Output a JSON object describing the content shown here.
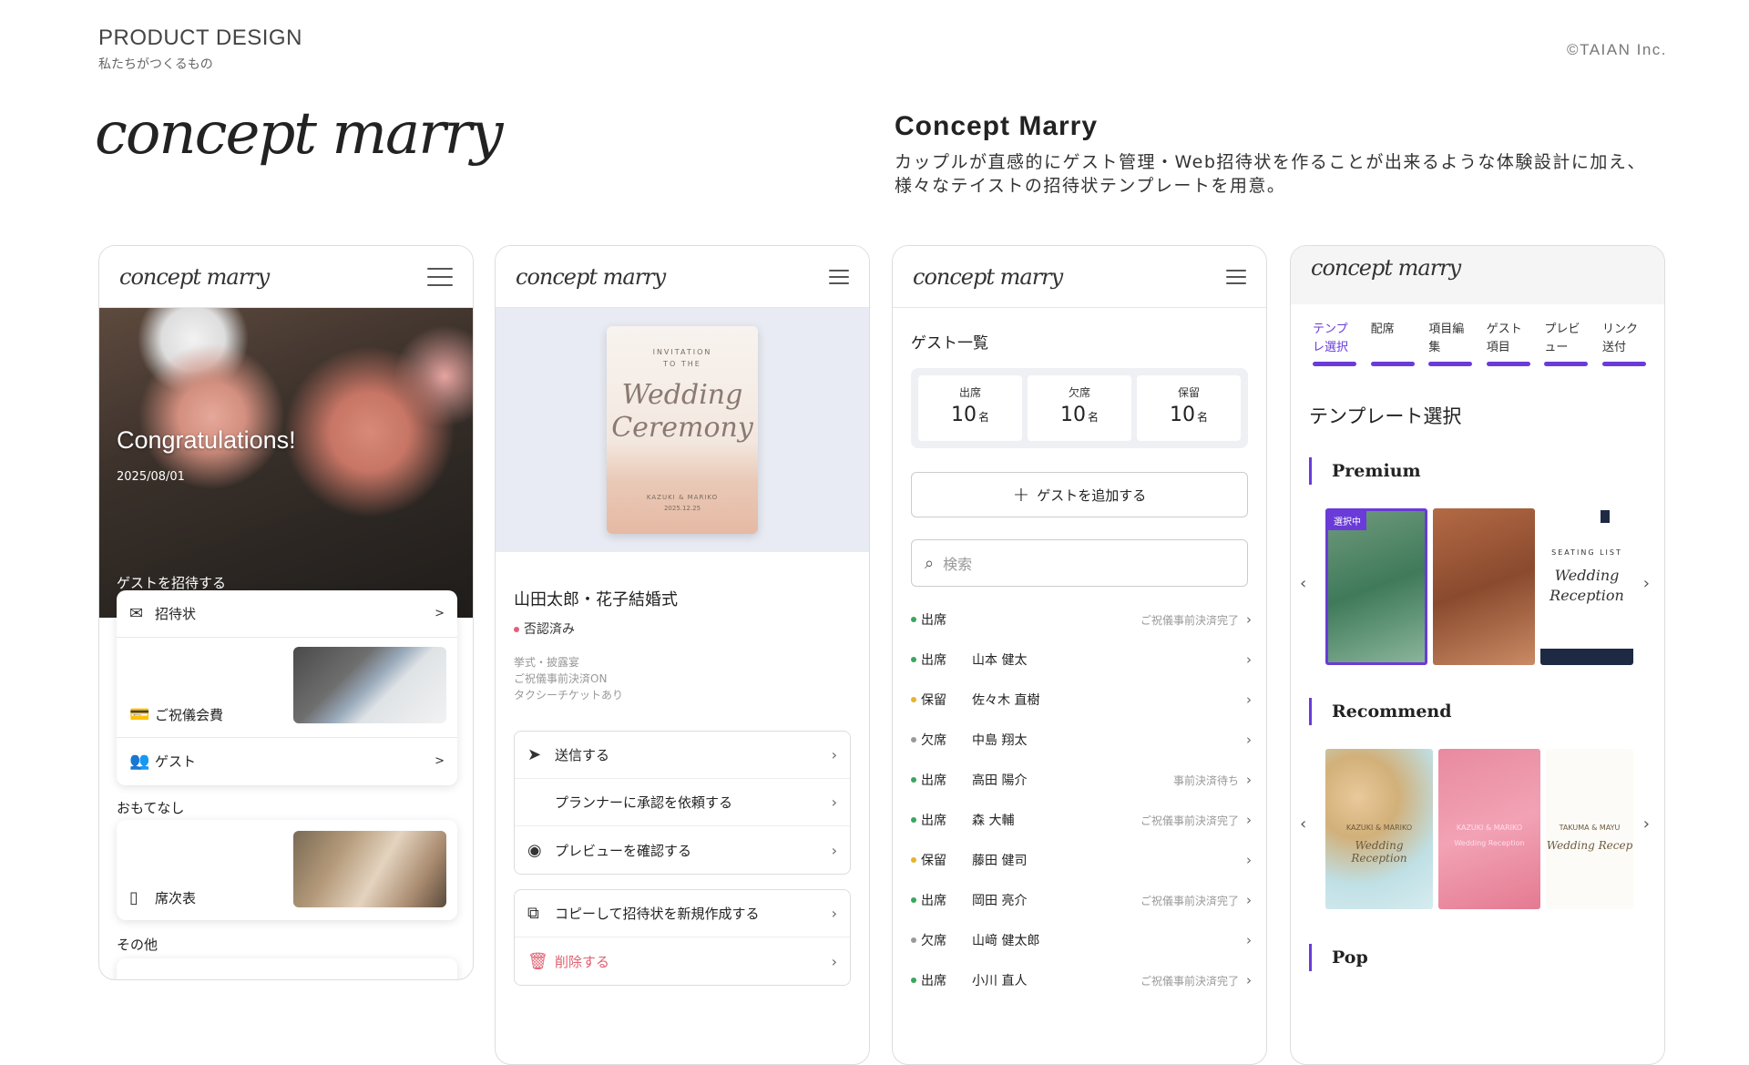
{
  "header": {
    "title": "PRODUCT DESIGN",
    "subtitle": "私たちがつくるもの",
    "copyright": "©TAIAN Inc."
  },
  "brand": {
    "logo_text": "concept marry"
  },
  "concept": {
    "title": "Concept Marry",
    "description": "カップルが直感的にゲスト管理・Web招待状を作ることが出来るような体験設計に加え、様々なテイストの招待状テンプレートを用意。"
  },
  "phone1": {
    "logo": "concept marry",
    "hero_title": "Congratulations!",
    "hero_date": "2025/08/01",
    "invite_section": "ゲストを招待する",
    "items": [
      {
        "label": "招待状",
        "icon": "envelope-icon",
        "chev": ">"
      },
      {
        "label": "ご祝儀会費",
        "icon": "money-icon",
        "chev": ">"
      },
      {
        "label": "ゲスト",
        "icon": "users-icon",
        "chev": ">"
      }
    ],
    "hospitality_section": "おもてなし",
    "seating": {
      "label": "席次表",
      "icon": "document-icon"
    },
    "other_section": "その他"
  },
  "phone2": {
    "logo": "concept marry",
    "card": {
      "line1": "INVITATION",
      "line2": "TO THE",
      "script": "Wedding Ceremony",
      "names": "KAZUKI & MARIKO",
      "date": "2025.12.25"
    },
    "event_name": "山田太郎・花子結婚式",
    "status": "否認済み",
    "notes": [
      "挙式・披露宴",
      "ご祝儀事前決済ON",
      "タクシーチケットあり"
    ],
    "actions": [
      {
        "label": "送信する",
        "icon": "send-icon"
      },
      {
        "label": "プランナーに承認を依頼する",
        "icon": ""
      },
      {
        "label": "プレビューを確認する",
        "icon": "eye-icon"
      }
    ],
    "actions2": [
      {
        "label": "コピーして招待状を新規作成する",
        "icon": "copy-icon"
      },
      {
        "label": "削除する",
        "icon": "trash-icon"
      }
    ]
  },
  "phone3": {
    "logo": "concept marry",
    "title": "ゲスト一覧",
    "stats": [
      {
        "label": "出席",
        "value": "10",
        "unit": "名"
      },
      {
        "label": "欠席",
        "value": "10",
        "unit": "名"
      },
      {
        "label": "保留",
        "value": "10",
        "unit": "名"
      }
    ],
    "add_label": "ゲストを追加する",
    "search_placeholder": "検索",
    "guests": [
      {
        "status": "出席",
        "name": "",
        "note": "ご祝儀事前決済完了",
        "color": "#3aa55d"
      },
      {
        "status": "出席",
        "name": "山本 健太",
        "note": "",
        "color": "#3aa55d"
      },
      {
        "status": "保留",
        "name": "佐々木 直樹",
        "note": "",
        "color": "#e6b32e"
      },
      {
        "status": "欠席",
        "name": "中島 翔太",
        "note": "",
        "color": "#999999"
      },
      {
        "status": "出席",
        "name": "高田 陽介",
        "note": "事前決済待ち",
        "color": "#3aa55d"
      },
      {
        "status": "出席",
        "name": "森 大輔",
        "note": "ご祝儀事前決済完了",
        "color": "#3aa55d"
      },
      {
        "status": "保留",
        "name": "藤田 健司",
        "note": "",
        "color": "#e6b32e"
      },
      {
        "status": "出席",
        "name": "岡田 亮介",
        "note": "ご祝儀事前決済完了",
        "color": "#3aa55d"
      },
      {
        "status": "欠席",
        "name": "山﨑 健太郎",
        "note": "",
        "color": "#999999"
      },
      {
        "status": "出席",
        "name": "小川 直人",
        "note": "ご祝儀事前決済完了",
        "color": "#3aa55d"
      }
    ]
  },
  "phone4": {
    "logo": "concept marry",
    "tabs": [
      "テンプレ選択",
      "配席",
      "項目編集",
      "ゲスト項目",
      "プレビュー",
      "リンク送付"
    ],
    "heading": "テンプレート選択",
    "sections": [
      "Premium",
      "Recommend",
      "Pop"
    ],
    "selected_badge": "選択中",
    "premium_texts": [
      "SEATING LIST",
      "Wedding Reception"
    ],
    "recommend_texts": [
      "KAZUKI & MARIKO",
      "Wedding Reception",
      "KAZUKI & MARIKO",
      "Wedding Reception",
      "TAKUMA & MAYU",
      "Wedding Recep"
    ],
    "accent": "#6a3bd8"
  }
}
